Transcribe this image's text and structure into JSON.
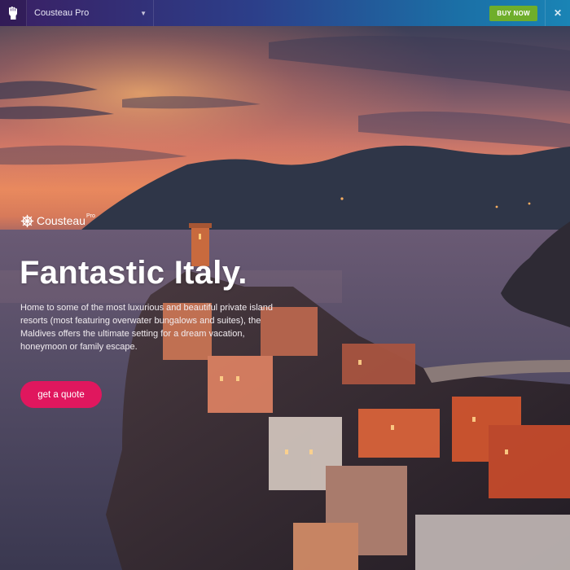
{
  "topbar": {
    "logo_icon": "raised-fist-icon",
    "theme_selector": {
      "value": "Cousteau Pro",
      "icon": "chevron-down-icon"
    },
    "buy_label": "BUY NOW",
    "close_icon": "close-icon",
    "close_glyph": "✕"
  },
  "brand": {
    "icon": "ship-wheel-icon",
    "name": "Cousteau",
    "suffix": "Pro"
  },
  "hero": {
    "title": "Fantastic Italy.",
    "description": "Home to some of the most luxurious and beautiful private island resorts (most featuring overwater bungalows and suites), the Maldives offers the ultimate setting for a dream vacation, honeymoon or family escape.",
    "cta_label": "get a quote"
  },
  "colors": {
    "accent": "#e0175e",
    "buy_button": "#6fae2b",
    "topbar_start": "#3a1f63",
    "topbar_end": "#1a84b5"
  }
}
